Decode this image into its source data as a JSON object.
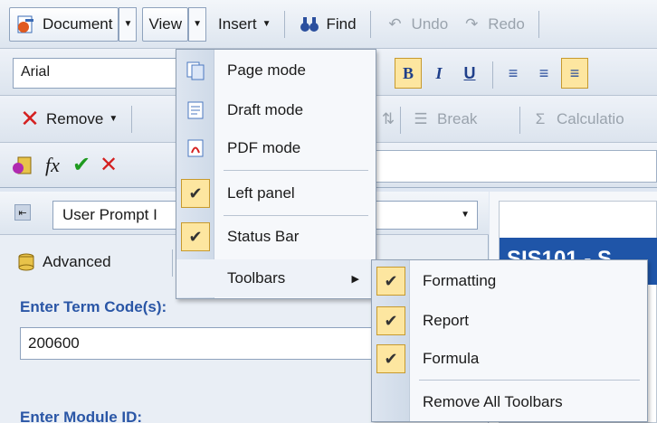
{
  "toolbar1": {
    "document_label": "Document",
    "view_label": "View",
    "insert_label": "Insert",
    "find_label": "Find",
    "undo_label": "Undo",
    "redo_label": "Redo"
  },
  "toolbar2": {
    "font_value": "Arial",
    "bold": "B",
    "italic": "I",
    "underline": "U"
  },
  "toolbar3": {
    "remove_label": "Remove",
    "break_label": "Break",
    "calculation_label": "Calculatio"
  },
  "left_panel": {
    "prompt_select_value": "User Prompt I",
    "advanced_label": "Advanced",
    "term_label": "Enter Term Code(s):",
    "term_value": "200600",
    "module_label": "Enter Module ID:"
  },
  "document": {
    "banner_text": "SIS101 - S"
  },
  "view_menu": {
    "items": [
      {
        "label": "Page mode",
        "icon": "page-mode-icon"
      },
      {
        "label": "Draft mode",
        "icon": "draft-mode-icon"
      },
      {
        "label": "PDF mode",
        "icon": "pdf-icon"
      },
      {
        "label": "Left panel",
        "checked": true
      },
      {
        "label": "Status Bar",
        "checked": true
      },
      {
        "label": "Toolbars"
      }
    ]
  },
  "toolbars_submenu": {
    "items": [
      {
        "label": "Formatting",
        "checked": true
      },
      {
        "label": "Report",
        "checked": true
      },
      {
        "label": "Formula",
        "checked": true
      },
      {
        "label": "Remove All Toolbars",
        "checked": false
      }
    ]
  },
  "colors": {
    "accent_blue": "#1f55a8",
    "check_highlight": "#fde6a0",
    "remove_red": "#d42020",
    "validate_green": "#1f9a1f",
    "label_blue": "#2a56a6"
  }
}
